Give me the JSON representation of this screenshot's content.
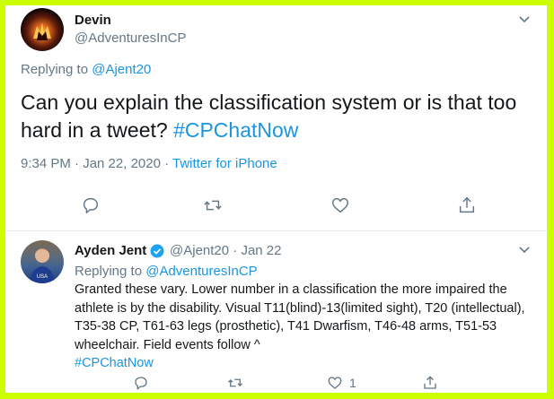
{
  "main_tweet": {
    "author_name": "Devin",
    "author_handle": "@AdventuresInCP",
    "replying_prefix": "Replying to ",
    "replying_to": "@Ajent20",
    "text": "Can you explain the classification system or is that too hard in a tweet? ",
    "hashtag": "#CPChatNow",
    "time": "9:34 PM · Jan 22, 2020 · ",
    "source": "Twitter for iPhone",
    "icons": [
      "reply-icon",
      "retweet-icon",
      "like-icon",
      "share-icon",
      "chevron-down-icon"
    ]
  },
  "reply_tweet": {
    "author_name": "Ayden Jent",
    "author_handle": "@Ajent20",
    "date": " · Jan 22",
    "replying_prefix": "Replying to ",
    "replying_to": "@AdventuresInCP",
    "text": "Granted these vary. Lower number in a classification the more impaired the athlete is by the disability. Visual T11(blind)-13(limited sight), T20 (intellectual), T35-38 CP, T61-63 legs (prosthetic), T41 Dwarfism, T46-48 arms, T51-53 wheelchair. Field events follow ^",
    "hashtag": "#CPChatNow",
    "like_count": "1",
    "avatar_text": "USA",
    "icons": [
      "verified-badge-icon",
      "reply-icon",
      "retweet-icon",
      "like-icon",
      "share-icon",
      "chevron-down-icon"
    ]
  },
  "colors": {
    "frame": "#ccff00",
    "link": "#1b95e0",
    "secondary_text": "#657786",
    "verified": "#1da1f2"
  }
}
